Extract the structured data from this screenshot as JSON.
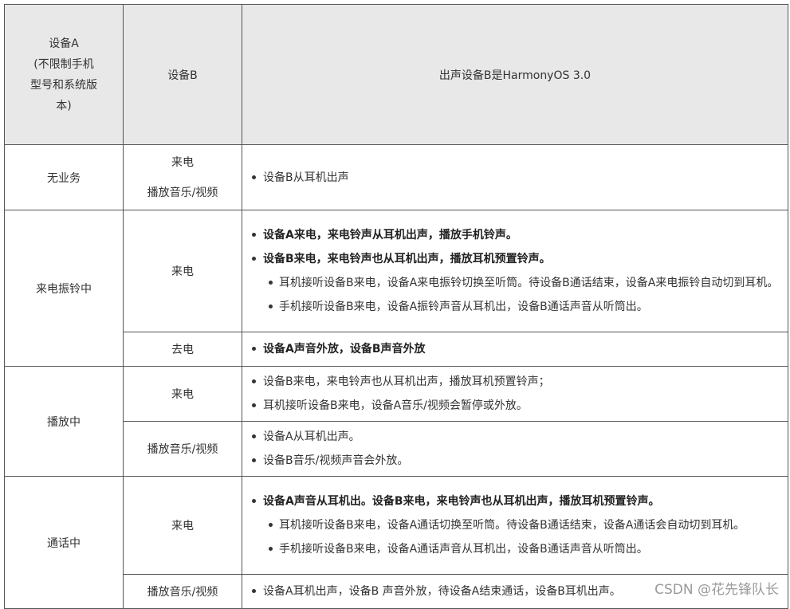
{
  "header": {
    "device_a": "设备A",
    "device_a_note": [
      "(不限制手机",
      "型号和系统版",
      "本)"
    ],
    "device_b": "设备B",
    "output": "出声设备B是HarmonyOS 3.0"
  },
  "rows": {
    "idle": {
      "label": "无业务",
      "b_lines": [
        "来电",
        "播放音乐/视频"
      ],
      "bullets": [
        "设备B从耳机出声"
      ]
    },
    "ringing": {
      "label": "来电振铃中",
      "incoming": {
        "b": "来电",
        "bold1": "设备A来电，来电铃声从耳机出声，播放手机铃声。",
        "bold2": "设备B来电，来电铃声也从耳机出声，播放耳机预置铃声。",
        "sub1": "耳机接听设备B来电，设备A来电振铃切换至听筒。待设备B通话结束，设备A来电振铃自动切到耳机。",
        "sub2": "手机接听设备B来电，设备A振铃声音从耳机出，设备B通话声音从听筒出。"
      },
      "outgoing": {
        "b": "去电",
        "bold1": "设备A声音外放，设备B声音外放"
      }
    },
    "playing": {
      "label": "播放中",
      "incoming": {
        "b": "来电",
        "b1": "设备B来电，来电铃声也从耳机出声，播放耳机预置铃声；",
        "b2": "耳机接听设备B来电，设备A音乐/视频会暂停或外放。"
      },
      "media": {
        "b": "播放音乐/视频",
        "b1": "设备A从耳机出声。",
        "b2": "设备B音乐/视频声音会外放。"
      }
    },
    "calling": {
      "label": "通话中",
      "incoming": {
        "b": "来电",
        "bold1": "设备A声音从耳机出。设备B来电，来电铃声也从耳机出声，播放耳机预置铃声。",
        "sub1": "耳机接听设备B来电，设备A通话切换至听筒。待设备B通话结束，设备A通话会自动切到耳机。",
        "sub2": "手机接听设备B来电，设备A通话声音从耳机出，设备B通话声音从听筒出。"
      },
      "media": {
        "b": "播放音乐/视频",
        "b1": "设备A耳机出声，设备B 声音外放，待设备A结束通话，设备B耳机出声。"
      }
    }
  },
  "watermark": "CSDN @花先锋队长"
}
